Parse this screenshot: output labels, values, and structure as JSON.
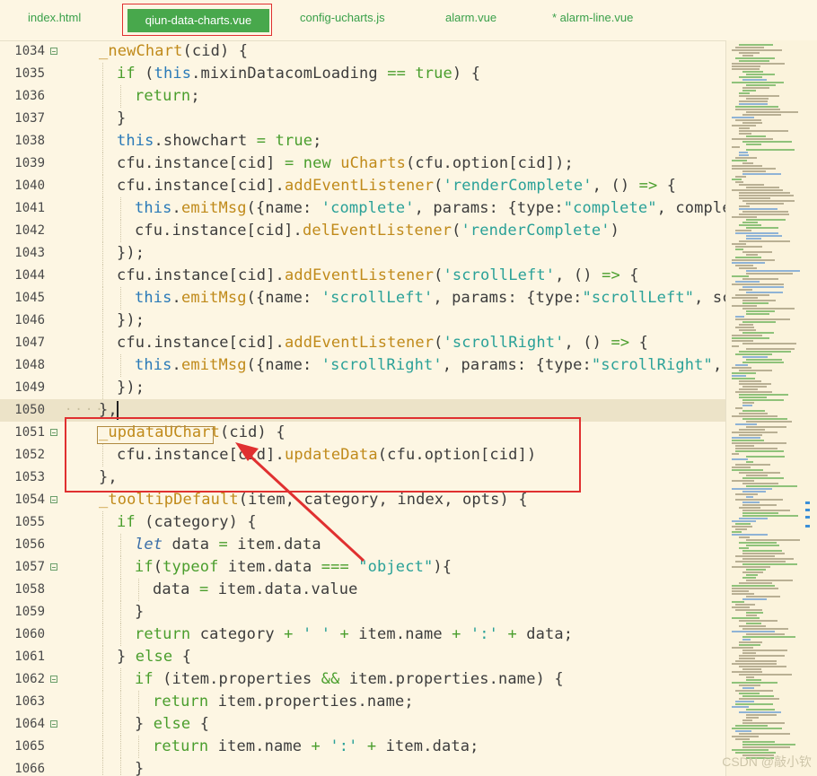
{
  "tabs": [
    {
      "label": "index.html",
      "active": false
    },
    {
      "label": "qiun-data-charts.vue",
      "active": true
    },
    {
      "label": "config-ucharts.js",
      "active": false
    },
    {
      "label": "alarm.vue",
      "active": false
    },
    {
      "label": "* alarm-line.vue",
      "active": false
    }
  ],
  "watermark": "CSDN @敲小钦",
  "colors": {
    "accent": "#48a84c",
    "highlight": "#e03030",
    "background": "#fdf6e3"
  },
  "lines": [
    {
      "n": "1034",
      "fold": true,
      "indent": 1,
      "tokens": [
        [
          "fn",
          "_newChart"
        ],
        [
          "op",
          "(cid) {"
        ]
      ]
    },
    {
      "n": "1035",
      "fold": false,
      "indent": 2,
      "tokens": [
        [
          "kw",
          "if"
        ],
        [
          "op",
          " ("
        ],
        [
          "kw2",
          "this"
        ],
        [
          "op",
          ".mixinDatacomLoading "
        ],
        [
          "kw",
          "=="
        ],
        [
          "op",
          " "
        ],
        [
          "kw",
          "true"
        ],
        [
          "op",
          ") {"
        ]
      ]
    },
    {
      "n": "1036",
      "fold": false,
      "indent": 3,
      "tokens": [
        [
          "kw",
          "return"
        ],
        [
          "op",
          ";"
        ]
      ]
    },
    {
      "n": "1037",
      "fold": false,
      "indent": 2,
      "tokens": [
        [
          "op",
          "}"
        ]
      ]
    },
    {
      "n": "1038",
      "fold": false,
      "indent": 2,
      "tokens": [
        [
          "kw2",
          "this"
        ],
        [
          "op",
          ".showchart "
        ],
        [
          "kw",
          "="
        ],
        [
          "op",
          " "
        ],
        [
          "kw",
          "true"
        ],
        [
          "op",
          ";"
        ]
      ]
    },
    {
      "n": "1039",
      "fold": false,
      "indent": 2,
      "tokens": [
        [
          "op",
          "cfu.instance[cid] "
        ],
        [
          "kw",
          "="
        ],
        [
          "op",
          " "
        ],
        [
          "kw",
          "new"
        ],
        [
          "op",
          " "
        ],
        [
          "fn",
          "uCharts"
        ],
        [
          "op",
          "(cfu.option[cid]);"
        ]
      ]
    },
    {
      "n": "1040",
      "fold": false,
      "indent": 2,
      "tokens": [
        [
          "op",
          "cfu.instance[cid]."
        ],
        [
          "fn",
          "addEventListener"
        ],
        [
          "op",
          "("
        ],
        [
          "str",
          "'renderComplete'"
        ],
        [
          "op",
          ", () "
        ],
        [
          "kw",
          "=>"
        ],
        [
          "op",
          " {"
        ]
      ]
    },
    {
      "n": "1041",
      "fold": false,
      "indent": 3,
      "tokens": [
        [
          "kw2",
          "this"
        ],
        [
          "op",
          "."
        ],
        [
          "fn",
          "emitMsg"
        ],
        [
          "op",
          "({name: "
        ],
        [
          "str",
          "'complete'"
        ],
        [
          "op",
          ", params: {type:"
        ],
        [
          "str",
          "\"complete\""
        ],
        [
          "op",
          ", complete"
        ]
      ]
    },
    {
      "n": "1042",
      "fold": false,
      "indent": 3,
      "tokens": [
        [
          "op",
          "cfu.instance[cid]."
        ],
        [
          "fn",
          "delEventListener"
        ],
        [
          "op",
          "("
        ],
        [
          "str",
          "'renderComplete'"
        ],
        [
          "op",
          ")"
        ]
      ]
    },
    {
      "n": "1043",
      "fold": false,
      "indent": 2,
      "tokens": [
        [
          "op",
          "});"
        ]
      ]
    },
    {
      "n": "1044",
      "fold": false,
      "indent": 2,
      "tokens": [
        [
          "op",
          "cfu.instance[cid]."
        ],
        [
          "fn",
          "addEventListener"
        ],
        [
          "op",
          "("
        ],
        [
          "str",
          "'scrollLeft'"
        ],
        [
          "op",
          ", () "
        ],
        [
          "kw",
          "=>"
        ],
        [
          "op",
          " {"
        ]
      ]
    },
    {
      "n": "1045",
      "fold": false,
      "indent": 3,
      "tokens": [
        [
          "kw2",
          "this"
        ],
        [
          "op",
          "."
        ],
        [
          "fn",
          "emitMsg"
        ],
        [
          "op",
          "({name: "
        ],
        [
          "str",
          "'scrollLeft'"
        ],
        [
          "op",
          ", params: {type:"
        ],
        [
          "str",
          "\"scrollLeft\""
        ],
        [
          "op",
          ", scro"
        ]
      ]
    },
    {
      "n": "1046",
      "fold": false,
      "indent": 2,
      "tokens": [
        [
          "op",
          "});"
        ]
      ]
    },
    {
      "n": "1047",
      "fold": false,
      "indent": 2,
      "tokens": [
        [
          "op",
          "cfu.instance[cid]."
        ],
        [
          "fn",
          "addEventListener"
        ],
        [
          "op",
          "("
        ],
        [
          "str",
          "'scrollRight'"
        ],
        [
          "op",
          ", () "
        ],
        [
          "kw",
          "=>"
        ],
        [
          "op",
          " {"
        ]
      ]
    },
    {
      "n": "1048",
      "fold": false,
      "indent": 3,
      "tokens": [
        [
          "kw2",
          "this"
        ],
        [
          "op",
          "."
        ],
        [
          "fn",
          "emitMsg"
        ],
        [
          "op",
          "({name: "
        ],
        [
          "str",
          "'scrollRight'"
        ],
        [
          "op",
          ", params: {type:"
        ],
        [
          "str",
          "\"scrollRight\""
        ],
        [
          "op",
          ", sc"
        ]
      ]
    },
    {
      "n": "1049",
      "fold": false,
      "indent": 2,
      "tokens": [
        [
          "op",
          "});"
        ]
      ]
    },
    {
      "n": "1050",
      "fold": false,
      "indent": 1,
      "current": true,
      "tokens": [
        [
          "op",
          "},"
        ]
      ]
    },
    {
      "n": "1051",
      "fold": true,
      "indent": 1,
      "tokens": [
        [
          "fn",
          "_updataUChart"
        ],
        [
          "op",
          "(cid) {"
        ]
      ]
    },
    {
      "n": "1052",
      "fold": false,
      "indent": 2,
      "tokens": [
        [
          "op",
          "cfu.instance[cid]."
        ],
        [
          "fn",
          "updateData"
        ],
        [
          "op",
          "(cfu.option[cid])"
        ]
      ]
    },
    {
      "n": "1053",
      "fold": false,
      "indent": 1,
      "tokens": [
        [
          "op",
          "},"
        ]
      ]
    },
    {
      "n": "1054",
      "fold": true,
      "indent": 1,
      "tokens": [
        [
          "fn",
          "_tooltipDefault"
        ],
        [
          "op",
          "(item, category, index, opts) {"
        ]
      ]
    },
    {
      "n": "1055",
      "fold": false,
      "indent": 2,
      "tokens": [
        [
          "kw",
          "if"
        ],
        [
          "op",
          " (category) {"
        ]
      ]
    },
    {
      "n": "1056",
      "fold": false,
      "indent": 3,
      "tokens": [
        [
          "it",
          "let"
        ],
        [
          "op",
          " data "
        ],
        [
          "kw",
          "="
        ],
        [
          "op",
          " item.data"
        ]
      ]
    },
    {
      "n": "1057",
      "fold": true,
      "indent": 3,
      "tokens": [
        [
          "kw",
          "if"
        ],
        [
          "op",
          "("
        ],
        [
          "kw",
          "typeof"
        ],
        [
          "op",
          " item.data "
        ],
        [
          "kw",
          "==="
        ],
        [
          "op",
          " "
        ],
        [
          "str",
          "\"object\""
        ],
        [
          "op",
          "){"
        ]
      ]
    },
    {
      "n": "1058",
      "fold": false,
      "indent": 4,
      "tokens": [
        [
          "op",
          "data "
        ],
        [
          "kw",
          "="
        ],
        [
          "op",
          " item.data.value"
        ]
      ]
    },
    {
      "n": "1059",
      "fold": false,
      "indent": 3,
      "tokens": [
        [
          "op",
          "}"
        ]
      ]
    },
    {
      "n": "1060",
      "fold": false,
      "indent": 3,
      "tokens": [
        [
          "kw",
          "return"
        ],
        [
          "op",
          " category "
        ],
        [
          "kw",
          "+"
        ],
        [
          "op",
          " "
        ],
        [
          "str",
          "' '"
        ],
        [
          "op",
          " "
        ],
        [
          "kw",
          "+"
        ],
        [
          "op",
          " item.name "
        ],
        [
          "kw",
          "+"
        ],
        [
          "op",
          " "
        ],
        [
          "str",
          "':'"
        ],
        [
          "op",
          " "
        ],
        [
          "kw",
          "+"
        ],
        [
          "op",
          " data;"
        ]
      ]
    },
    {
      "n": "1061",
      "fold": false,
      "indent": 2,
      "tokens": [
        [
          "op",
          "} "
        ],
        [
          "kw",
          "else"
        ],
        [
          "op",
          " {"
        ]
      ]
    },
    {
      "n": "1062",
      "fold": true,
      "indent": 3,
      "tokens": [
        [
          "kw",
          "if"
        ],
        [
          "op",
          " (item.properties "
        ],
        [
          "kw",
          "&&"
        ],
        [
          "op",
          " item.properties.name) {"
        ]
      ]
    },
    {
      "n": "1063",
      "fold": false,
      "indent": 4,
      "tokens": [
        [
          "kw",
          "return"
        ],
        [
          "op",
          " item.properties.name;"
        ]
      ]
    },
    {
      "n": "1064",
      "fold": true,
      "indent": 3,
      "tokens": [
        [
          "op",
          "} "
        ],
        [
          "kw",
          "else"
        ],
        [
          "op",
          " {"
        ]
      ]
    },
    {
      "n": "1065",
      "fold": false,
      "indent": 4,
      "tokens": [
        [
          "kw",
          "return"
        ],
        [
          "op",
          " item.name "
        ],
        [
          "kw",
          "+"
        ],
        [
          "op",
          " "
        ],
        [
          "str",
          "':'"
        ],
        [
          "op",
          " "
        ],
        [
          "kw",
          "+"
        ],
        [
          "op",
          " item.data;"
        ]
      ]
    },
    {
      "n": "1066",
      "fold": false,
      "indent": 3,
      "tokens": [
        [
          "op",
          "}"
        ]
      ]
    }
  ]
}
